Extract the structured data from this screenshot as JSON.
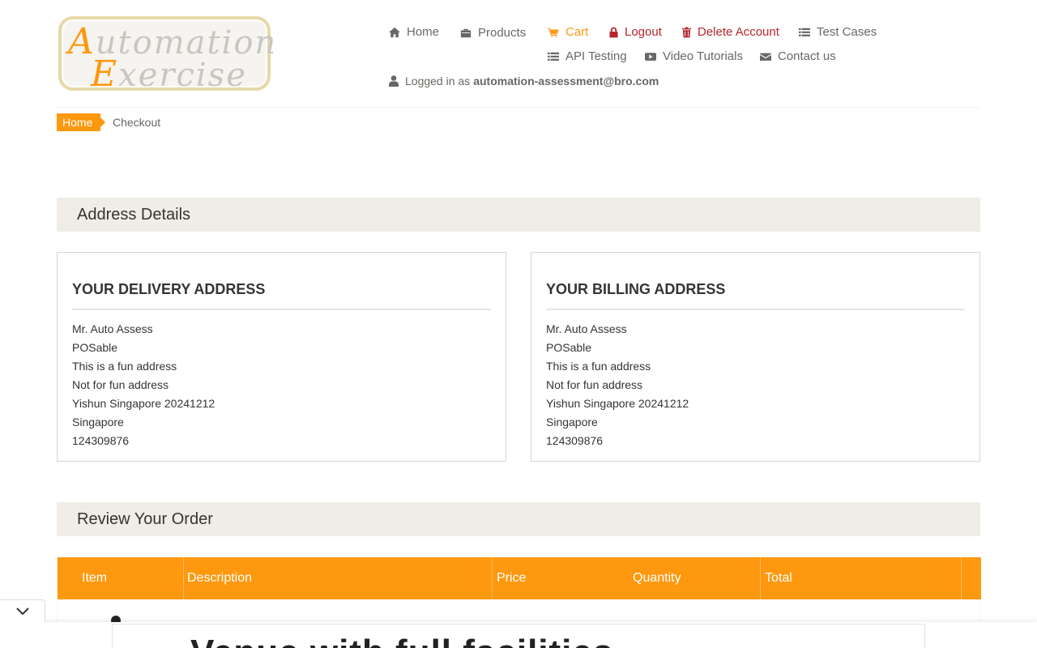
{
  "logo": {
    "line1_cap": "A",
    "line1_rest": "utomation",
    "line2_cap": "E",
    "line2_rest": "xercise"
  },
  "nav": {
    "home": "Home",
    "products": "Products",
    "cart": "Cart",
    "logout": "Logout",
    "delete_account": "Delete Account",
    "test_cases": "Test Cases",
    "api_testing": "API Testing",
    "video_tutorials": "Video Tutorials",
    "contact_us": "Contact us",
    "logged_in_prefix": "Logged in as",
    "logged_in_user": "automation-assessment@bro.com"
  },
  "breadcrumb": {
    "home": "Home",
    "current": "Checkout"
  },
  "address_section": {
    "title": "Address Details"
  },
  "delivery": {
    "title": "Your delivery address",
    "lines": [
      "Mr. Auto Assess",
      "POSable",
      "This is a fun address",
      "Not for fun address",
      "Yishun Singapore 20241212",
      "Singapore",
      "124309876"
    ]
  },
  "billing": {
    "title": "Your billing address",
    "lines": [
      "Mr. Auto Assess",
      "POSable",
      "This is a fun address",
      "Not for fun address",
      "Yishun Singapore 20241212",
      "Singapore",
      "124309876"
    ]
  },
  "review_section": {
    "title": "Review Your Order"
  },
  "table": {
    "headers": [
      "Item",
      "Description",
      "Price",
      "Quantity",
      "Total"
    ]
  },
  "ad": {
    "text": "Venue with full facilities"
  },
  "colors": {
    "accent": "#fe980f",
    "danger": "#b4262c",
    "section_bg": "#efede5",
    "text": "#696763"
  }
}
